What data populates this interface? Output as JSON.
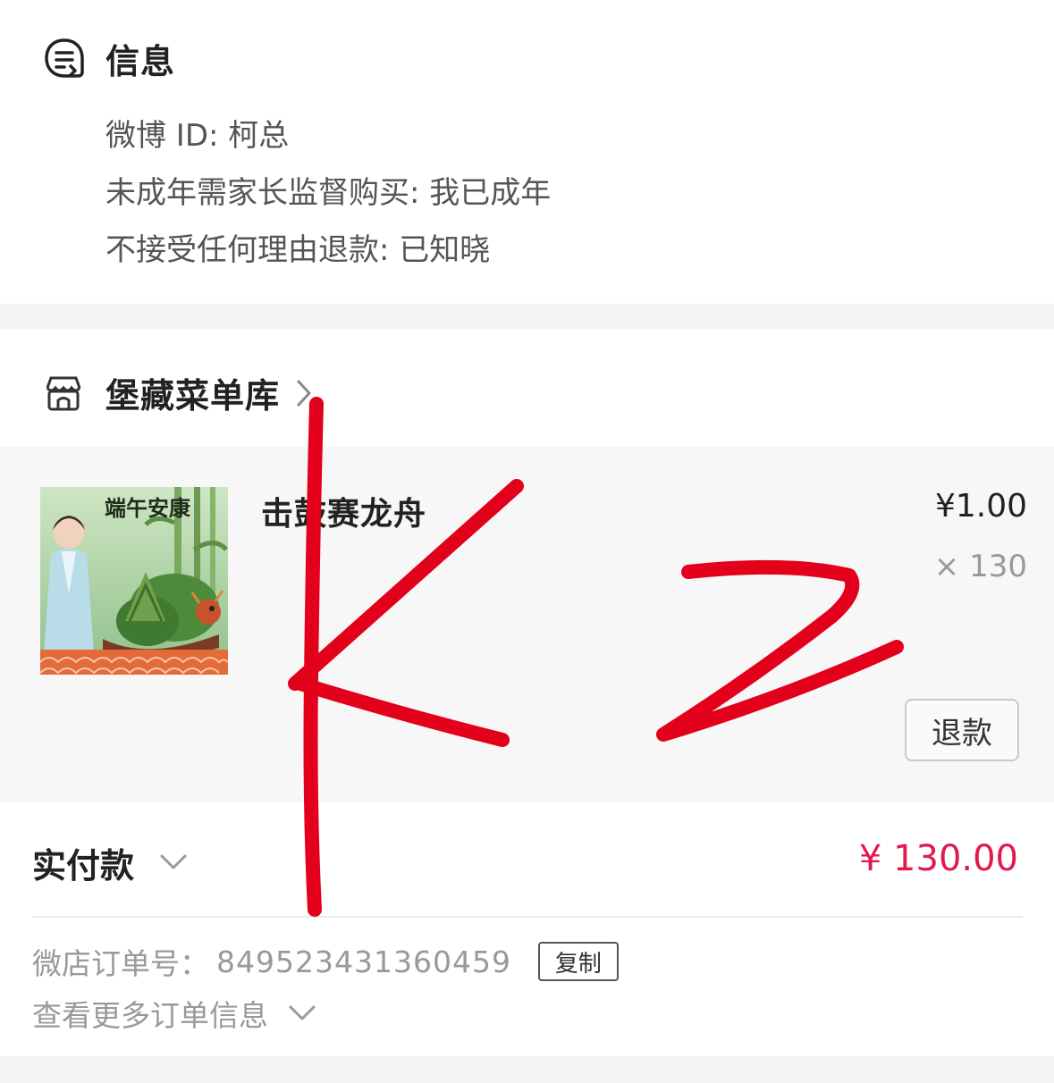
{
  "info": {
    "title": "信息",
    "lines": [
      "微博 ID: 柯总",
      "未成年需家长监督购买: 我已成年",
      "不接受任何理由退款: 已知晓"
    ]
  },
  "shop": {
    "name": "堡藏菜单库"
  },
  "item": {
    "title": "击鼓赛龙舟",
    "price": "¥1.00",
    "quantity": "× 130",
    "refund_label": "退款",
    "thumbnail_text": "端午安康"
  },
  "payment": {
    "label": "实付款",
    "amount": "¥ 130.00",
    "accent_color": "#e0194e"
  },
  "order": {
    "label": "微店订单号：",
    "number": "849523431360459",
    "copy_label": "复制",
    "more_label": "查看更多订单信息"
  },
  "overlay": {
    "handwriting": "KZ",
    "color": "#e3001b"
  },
  "icons": {
    "info": "message-list-icon",
    "shop": "store-icon",
    "shop_chevron": "chevron-right-icon",
    "paid_chevron": "chevron-down-icon",
    "more_chevron": "chevron-down-icon"
  }
}
